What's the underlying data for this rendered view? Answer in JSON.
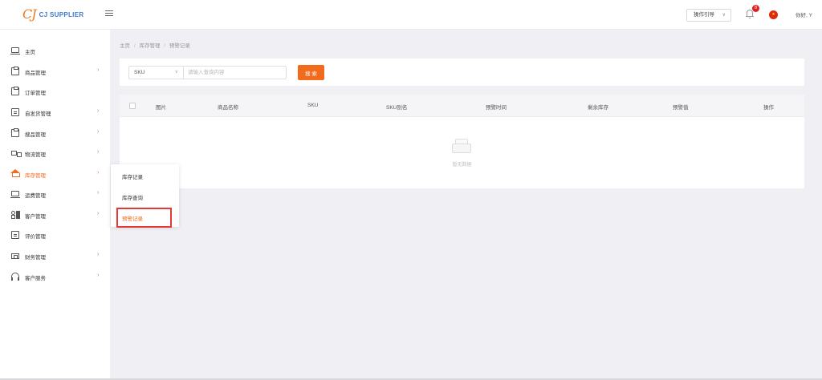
{
  "header": {
    "logo_mark": "CJ",
    "logo_text": "CJ SUPPLIER",
    "guide_label": "操作引导",
    "guide_chevron": "∨",
    "notification_count": "8",
    "greeting": "你好, Y",
    "brand_color": "#f26b1d"
  },
  "sidebar": {
    "items": [
      {
        "label": "主页",
        "icon": "monitor-icon",
        "arrow": ""
      },
      {
        "label": "商品管理",
        "icon": "clipboard-icon",
        "arrow": "›"
      },
      {
        "label": "订单管理",
        "icon": "clipboard-icon",
        "arrow": ""
      },
      {
        "label": "自发货管理",
        "icon": "document-icon",
        "arrow": "›"
      },
      {
        "label": "搜品管理",
        "icon": "clipboard-search-icon",
        "arrow": "›"
      },
      {
        "label": "物流管理",
        "icon": "truck-icon",
        "arrow": "›"
      },
      {
        "label": "库存管理",
        "icon": "warehouse-icon",
        "arrow": "›",
        "active": true
      },
      {
        "label": "运费管理",
        "icon": "image-icon",
        "arrow": "›"
      },
      {
        "label": "客户管理",
        "icon": "grid-icon",
        "arrow": "›"
      },
      {
        "label": "评价管理",
        "icon": "document-icon",
        "arrow": ""
      },
      {
        "label": "财务管理",
        "icon": "wallet-icon",
        "arrow": "›"
      },
      {
        "label": "客户服务",
        "icon": "headset-icon",
        "arrow": "›"
      }
    ]
  },
  "submenu": {
    "items": [
      {
        "label": "库存记录"
      },
      {
        "label": "库存查询"
      },
      {
        "label": "预警记录",
        "active": true
      }
    ]
  },
  "breadcrumb": [
    "主页",
    "库存管理",
    "预警记录"
  ],
  "breadcrumb_sep": "/",
  "search": {
    "select_value": "SKU",
    "select_chevron": "∨",
    "placeholder": "请输入查询内容",
    "button_label": "搜 索"
  },
  "table": {
    "columns": [
      "图片",
      "商品名称",
      "SKU",
      "SKU别名",
      "预警时间",
      "剩余库存",
      "预警值",
      "操作"
    ],
    "empty_text": "暂无数据"
  }
}
